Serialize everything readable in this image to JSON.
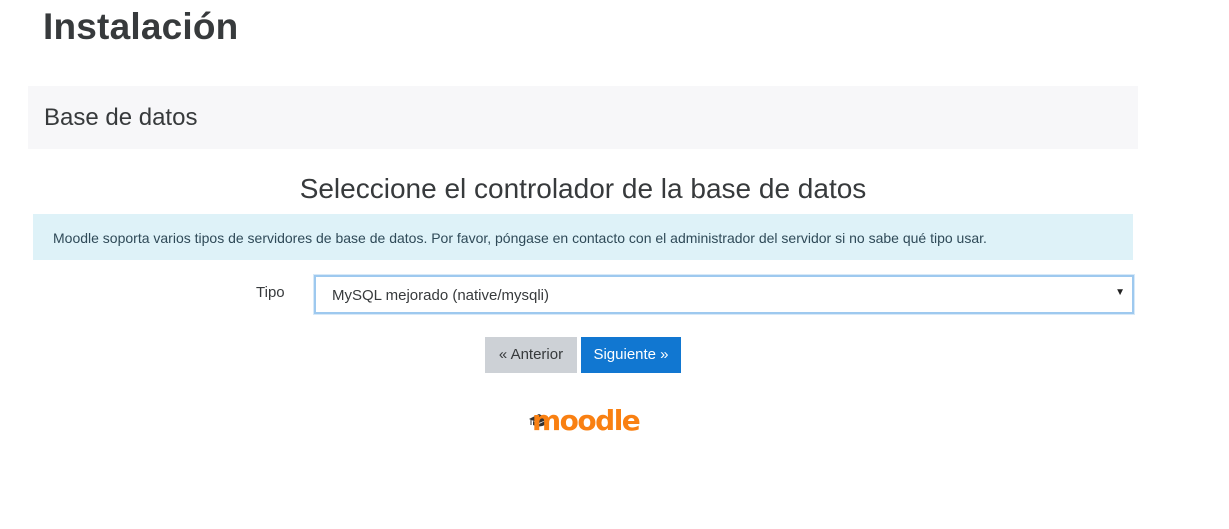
{
  "page": {
    "title": "Instalación"
  },
  "section": {
    "title": "Base de datos"
  },
  "step": {
    "heading": "Seleccione el controlador de la base de datos",
    "info": "Moodle soporta varios tipos de servidores de base de datos. Por favor, póngase en contacto con el administrador del servidor si no sabe qué tipo usar."
  },
  "form": {
    "type_label": "Tipo",
    "type_selected": "MySQL mejorado (native/mysqli)"
  },
  "buttons": {
    "previous": "« Anterior",
    "next": "Siguiente »"
  },
  "footer": {
    "logo_text": "moodle",
    "logo_icon": "mortarboard-icon"
  },
  "colors": {
    "accent": "#1177d1",
    "info_bg": "#def2f8",
    "section_bg": "#f7f7f9",
    "secondary_button": "#cdd1d6",
    "logo_orange": "#f98012"
  }
}
